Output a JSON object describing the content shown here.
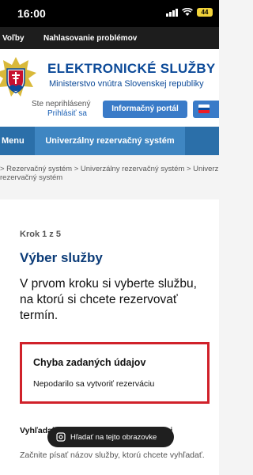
{
  "status_bar": {
    "time": "16:00",
    "battery": "44"
  },
  "topnav": {
    "items": [
      "Voľby",
      "Nahlasovanie problémov"
    ]
  },
  "header": {
    "title": "ELEKTRONICKÉ SLUŽBY",
    "subtitle": "Ministerstvo vnútra Slovenskej republiky",
    "login_status": "Ste neprihlásený",
    "login_link": "Prihlásiť sa",
    "portal_button": "Informačný portál"
  },
  "nav": {
    "menu": "Menu",
    "active_tab": "Univerzálny rezervačný systém"
  },
  "breadcrumb": {
    "line1": "> Rezervačný systém > Univerzálny rezervačný systém > Univerz",
    "line2": "rezervačný systém"
  },
  "main": {
    "step": "Krok 1 z 5",
    "title": "Výber služby",
    "intro": "V prvom kroku si vyberte službu, na ktorú si chcete rezervovať termín.",
    "error": {
      "title": "Chyba zadaných údajov",
      "message": "Nepodarilo sa vytvoriť rezerváciu"
    },
    "field_label": "Vyhľadajte službu, ktorú chcete vybavi",
    "field_hint": "Začnite písať názov služby, ktorú chcete vyhľadať."
  },
  "find_on_page": {
    "label": "Hľadať na tejto obrazovke"
  },
  "colors": {
    "brand_blue": "#0c4a98",
    "nav_blue": "#2b6fa9",
    "error_red": "#d0212a"
  }
}
